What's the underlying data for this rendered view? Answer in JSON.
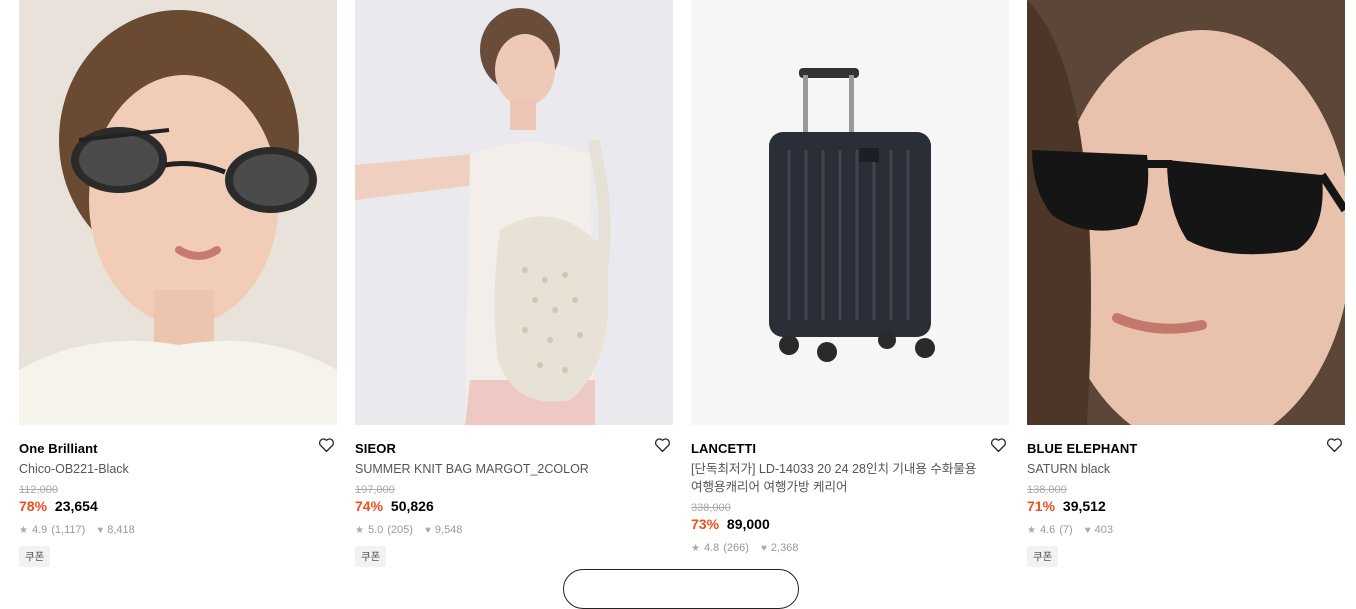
{
  "products": [
    {
      "brand": "One Brilliant",
      "name": "Chico-OB221-Black",
      "original_price": "112,000",
      "discount": "78%",
      "price": "23,654",
      "rating": "4.9",
      "reviews": "(1,117)",
      "likes": "8,418",
      "badge": "쿠폰"
    },
    {
      "brand": "SIEOR",
      "name": "SUMMER KNIT BAG MARGOT_2COLOR",
      "original_price": "197,000",
      "discount": "74%",
      "price": "50,826",
      "rating": "5.0",
      "reviews": "(205)",
      "likes": "9,548",
      "badge": "쿠폰"
    },
    {
      "brand": "LANCETTI",
      "name": "[단독최저가] LD-14033 20 24 28인치 기내용 수화물용 여행용캐리어 여행가방 케리어",
      "original_price": "338,000",
      "discount": "73%",
      "price": "89,000",
      "rating": "4.8",
      "reviews": "(266)",
      "likes": "2,368",
      "badge": ""
    },
    {
      "brand": "BLUE ELEPHANT",
      "name": "SATURN black",
      "original_price": "138,000",
      "discount": "71%",
      "price": "39,512",
      "rating": "4.6",
      "reviews": "(7)",
      "likes": "403",
      "badge": "쿠폰"
    }
  ],
  "icons": {
    "like": "heart-outline-icon",
    "rating": "star-icon",
    "likes": "heart-filled-icon"
  },
  "colors": {
    "discount": "#f04e1c",
    "badge_bg": "#f2f2f2"
  }
}
